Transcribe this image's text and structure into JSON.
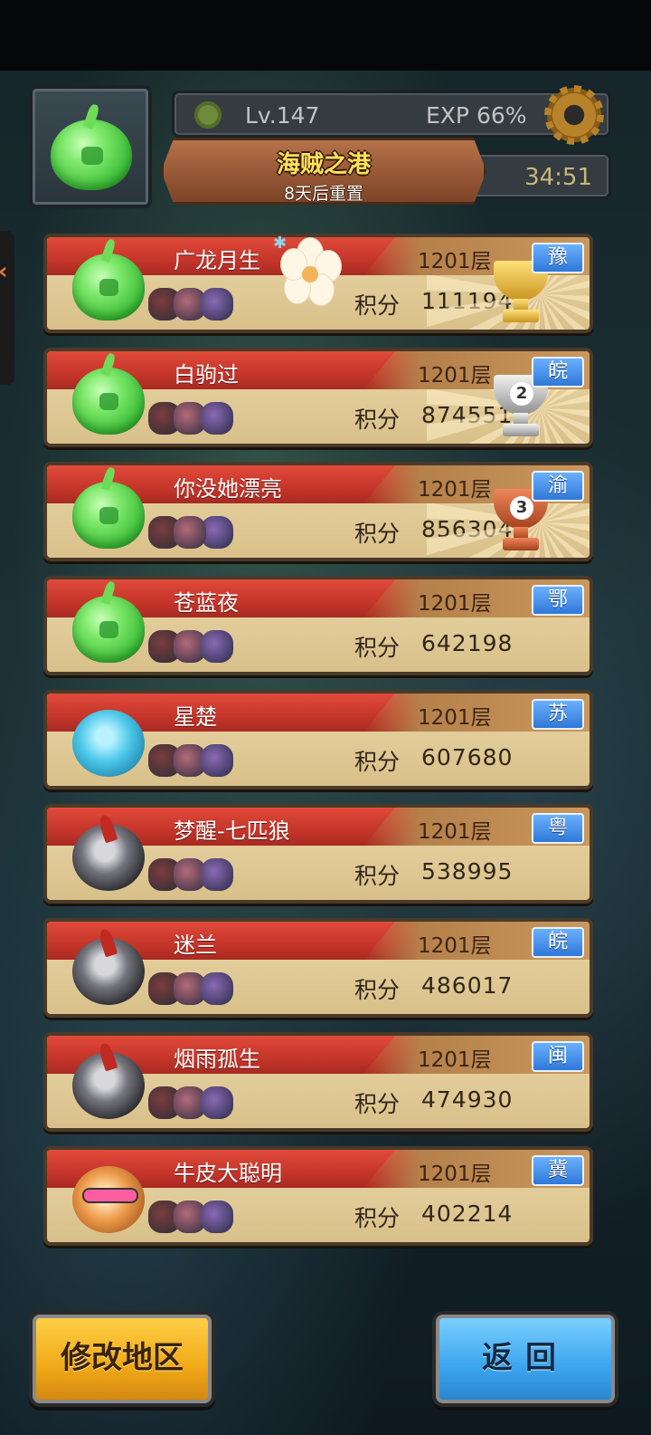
{
  "header": {
    "level": "Lv.147",
    "exp": "EXP 66%",
    "map_title": "海贼之港",
    "reset_text": "8天后重置",
    "timer": "34:51",
    "avatar_icon": "green-slime-icon",
    "settings_icon": "gear-icon"
  },
  "ranking": [
    {
      "name": "广龙月生",
      "floor": "1201层",
      "score_label": "积分",
      "score": "1111940",
      "region": "豫",
      "trophy": "gold",
      "avatar": "green-slime"
    },
    {
      "name": "白驹过",
      "floor": "1201层",
      "score_label": "积分",
      "score": "874551",
      "region": "皖",
      "trophy": "silver",
      "trophy_num": "2",
      "avatar": "green-slime"
    },
    {
      "name": "你没她漂亮",
      "floor": "1201层",
      "score_label": "积分",
      "score": "856304",
      "region": "渝",
      "trophy": "bronze",
      "trophy_num": "3",
      "avatar": "green-slime"
    },
    {
      "name": "苍蓝夜",
      "floor": "1201层",
      "score_label": "积分",
      "score": "642198",
      "region": "鄂",
      "avatar": "green-slime"
    },
    {
      "name": "星楚",
      "floor": "1201层",
      "score_label": "积分",
      "score": "607680",
      "region": "苏",
      "avatar": "blue-cat"
    },
    {
      "name": "梦醒-七匹狼",
      "floor": "1201层",
      "score_label": "积分",
      "score": "538995",
      "region": "粤",
      "avatar": "dark-beast"
    },
    {
      "name": "迷兰",
      "floor": "1201层",
      "score_label": "积分",
      "score": "486017",
      "region": "皖",
      "avatar": "dark-beast"
    },
    {
      "name": "烟雨孤生",
      "floor": "1201层",
      "score_label": "积分",
      "score": "474930",
      "region": "闽",
      "avatar": "dark-beast"
    },
    {
      "name": "牛皮大聪明",
      "floor": "1201层",
      "score_label": "积分",
      "score": "402214",
      "region": "冀",
      "avatar": "orange-fox"
    }
  ],
  "buttons": {
    "modify_region": "修改地区",
    "back": "返回"
  },
  "colors": {
    "banner_red": "#d63e31",
    "card_parchment": "#e2cb97",
    "region_badge_blue": "#3a86e0",
    "modify_button_yellow": "#f0a816",
    "back_button_blue": "#3aa4ee"
  }
}
